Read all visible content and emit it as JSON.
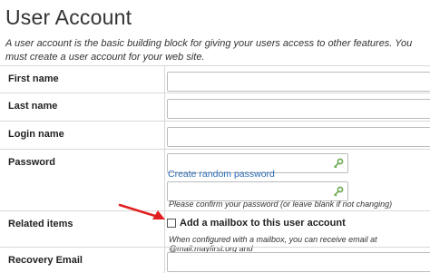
{
  "page": {
    "title": "User Account",
    "description": "A user account is the basic building block for giving your users access to other features. You must create a user account for your web site."
  },
  "form": {
    "first_name_label": "First name",
    "last_name_label": "Last name",
    "login_name_label": "Login name",
    "password_label": "Password",
    "create_password_link": "Create random password",
    "confirm_hint": "Please confirm your password (or leave blank if not changing)",
    "related_items_label": "Related items",
    "mailbox_checkbox_label": "Add a mailbox to this user account",
    "mailbox_hint": "When configured with a mailbox, you can receive email at @mail.mayfirst.org and",
    "recovery_email_label": "Recovery Email"
  },
  "colors": {
    "arrow": "#e02020",
    "link": "#2a6ab0",
    "key_icon": "#6aa84f"
  }
}
